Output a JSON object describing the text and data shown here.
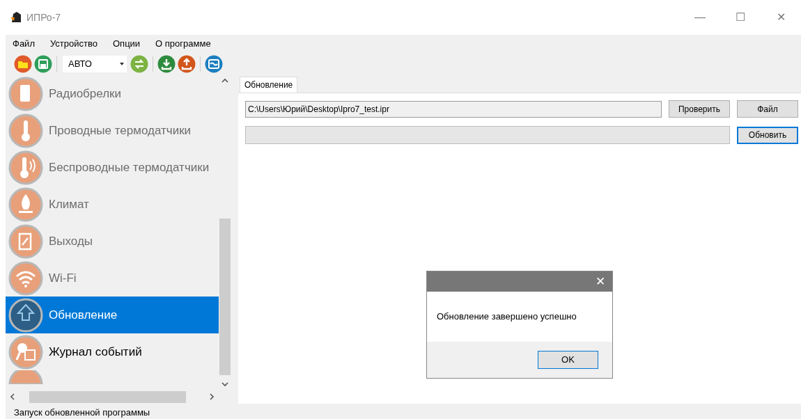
{
  "window": {
    "title": "ИПРо-7",
    "controls": [
      "—",
      "☐",
      "✕"
    ]
  },
  "menu": [
    "Файл",
    "Устройство",
    "Опции",
    "О программе"
  ],
  "toolbar": {
    "mode": "АВТО"
  },
  "sidebar": {
    "items": [
      {
        "label": "Радиобрелки",
        "enabled": false,
        "selected": false
      },
      {
        "label": "Проводные термодатчики",
        "enabled": false,
        "selected": false
      },
      {
        "label": "Беспроводные термодатчики",
        "enabled": false,
        "selected": false
      },
      {
        "label": "Климат",
        "enabled": false,
        "selected": false
      },
      {
        "label": "Выходы",
        "enabled": false,
        "selected": false
      },
      {
        "label": "Wi-Fi",
        "enabled": false,
        "selected": false
      },
      {
        "label": "Обновление",
        "enabled": true,
        "selected": true
      },
      {
        "label": "Журнал событий",
        "enabled": true,
        "selected": false
      }
    ]
  },
  "tabs": [
    {
      "label": "Обновление",
      "selected": true
    }
  ],
  "update": {
    "path": "C:\\Users\\Юрий\\Desktop\\Ipro7_test.ipr",
    "check_button": "Проверить",
    "file_button": "Файл",
    "progress": {
      "level": 0
    },
    "update_button": "Обновить"
  },
  "dialog": {
    "close": "✕",
    "message": "Обновление завершено успешно",
    "ok_button": "OK"
  },
  "status_bar": "Запуск обновленной программы"
}
